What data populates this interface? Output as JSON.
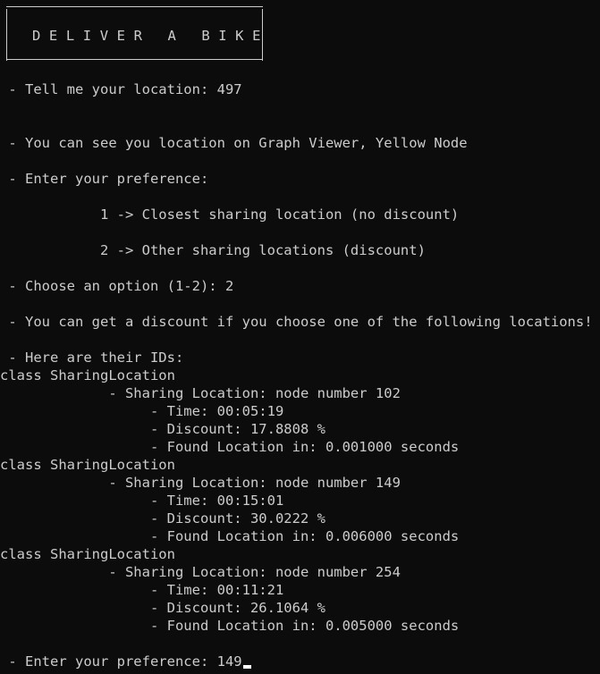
{
  "terminal": {
    "banner": {
      "title": "DELIVER A BIKE"
    },
    "prompts": {
      "location_prompt": " - Tell me your location: 497",
      "graph_hint": " - You can see you location on Graph Viewer, Yellow Node",
      "preference_prompt": " - Enter your preference:",
      "option_1": "            1 -> Closest sharing location (no discount)",
      "option_2": "            2 -> Other sharing locations (discount)",
      "choose_option": " - Choose an option (1-2): 2",
      "discount_msg": " - You can get a discount if you choose one of the following locations!",
      "ids_header": " - Here are their IDs:",
      "final_prompt": " - Enter your preference: 149"
    },
    "results": [
      {
        "class_line": "class SharingLocation",
        "location_line": "             - Sharing Location: node number 102",
        "time_line": "                  - Time: 00:05:19",
        "discount_line": "                  - Discount: 17.8808 %",
        "found_line": "                  - Found Location in: 0.001000 seconds"
      },
      {
        "class_line": "class SharingLocation",
        "location_line": "             - Sharing Location: node number 149",
        "time_line": "                  - Time: 00:15:01",
        "discount_line": "                  - Discount: 30.0222 %",
        "found_line": "                  - Found Location in: 0.006000 seconds"
      },
      {
        "class_line": "class SharingLocation",
        "location_line": "             - Sharing Location: node number 254",
        "time_line": "                  - Time: 00:11:21",
        "discount_line": "                  - Discount: 26.1064 %",
        "found_line": "                  - Found Location in: 0.005000 seconds"
      }
    ]
  },
  "colors": {
    "background": "#0c0c0c",
    "text": "#cccccc",
    "cursor": "#ffffff"
  }
}
